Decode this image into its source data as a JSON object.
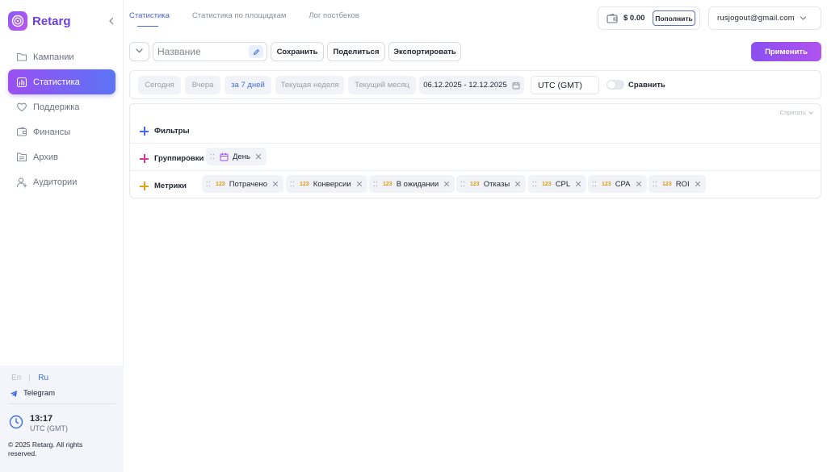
{
  "app": {
    "name": "Retarg"
  },
  "sidebar": {
    "items": [
      {
        "label": "Кампании",
        "icon": "folder-icon",
        "active": false
      },
      {
        "label": "Статистика",
        "icon": "chart-icon",
        "active": true
      },
      {
        "label": "Поддержка",
        "icon": "heart-icon",
        "active": false
      },
      {
        "label": "Финансы",
        "icon": "finance-icon",
        "active": false
      },
      {
        "label": "Архив",
        "icon": "archive-icon",
        "active": false
      },
      {
        "label": "Аудитории",
        "icon": "audience-icon",
        "active": false
      }
    ],
    "lang_en": "En",
    "lang_ru": "Ru",
    "telegram": "Telegram",
    "time": "13:17",
    "timezone": "UTC (GMT)",
    "copyright": "© 2025 Retarg. All rights reserved."
  },
  "tabs": [
    {
      "label": "Статистика",
      "active": true
    },
    {
      "label": "Статистика по площадкам",
      "active": false
    },
    {
      "label": "Лог постбеков",
      "active": false
    }
  ],
  "header": {
    "balance": "$ 0.00",
    "topup_label": "Пополнить",
    "account_email": "rusjogout@gmail.com"
  },
  "toolbar": {
    "name_placeholder": "Название",
    "save_label": "Сохранить",
    "share_label": "Поделиться",
    "export_label": "Экспортировать",
    "apply_label": "Применить"
  },
  "date_filter": {
    "presets": [
      {
        "label": "Сегодня",
        "selected": false
      },
      {
        "label": "Вчера",
        "selected": false
      },
      {
        "label": "за 7 дней",
        "selected": true
      },
      {
        "label": "Текущая неделя",
        "selected": false
      },
      {
        "label": "Текущий месяц",
        "selected": false
      }
    ],
    "range": "06.12.2025 - 12.12.2025",
    "timezone": "UTC (GMT)",
    "compare_label": "Сравнить",
    "compare_enabled": false
  },
  "filters": {
    "hide_label": "Спрятать",
    "filters_label": "Фильтры",
    "groupings_label": "Группировки",
    "groupings": [
      {
        "label": "День",
        "icon": "calendar-icon"
      }
    ],
    "metrics_label": "Метрики",
    "metric_type_badge": "123",
    "metrics": [
      {
        "label": "Потрачено"
      },
      {
        "label": "Конверсии"
      },
      {
        "label": "В ожидании"
      },
      {
        "label": "Отказы"
      },
      {
        "label": "CPL"
      },
      {
        "label": "CPA"
      },
      {
        "label": "ROI"
      }
    ]
  },
  "colors": {
    "accent": "#6d3fe0",
    "active_nav_start": "#9a4ff2",
    "active_nav_end": "#5b74f5",
    "link_blue": "#3d6ee0",
    "filters_plus": "#3b6fe0",
    "groupings_plus": "#d23aa0",
    "metrics_plus": "#e0a11c",
    "metric_badge": "#d99a12"
  }
}
